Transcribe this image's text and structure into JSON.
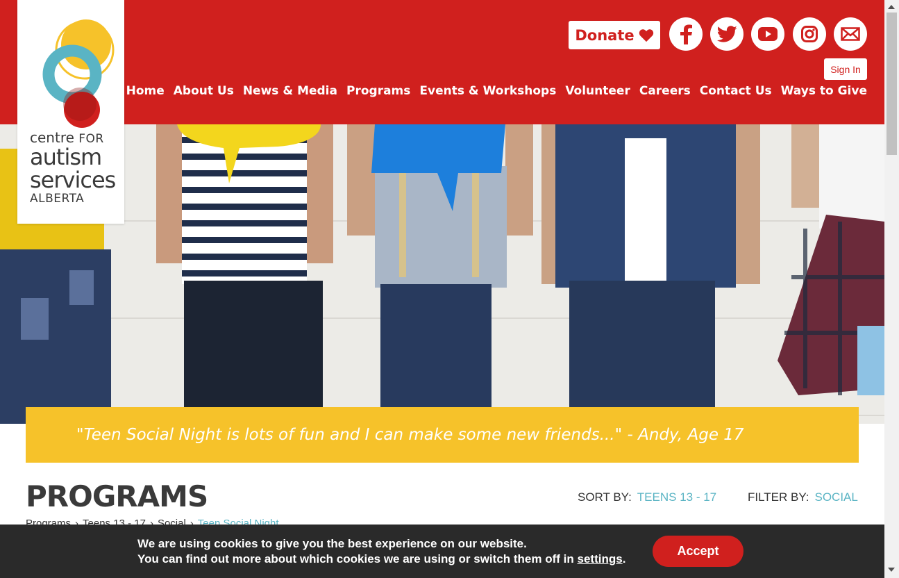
{
  "org": {
    "logo_line1": "centre",
    "logo_line1b": "FOR",
    "logo_line2": "autism",
    "logo_line3": "services",
    "logo_line4": "ALBERTA"
  },
  "header": {
    "donate_label": "Donate",
    "signin_label": "Sign In",
    "social": [
      "facebook-icon",
      "twitter-icon",
      "youtube-icon",
      "instagram-icon",
      "email-icon"
    ]
  },
  "nav": [
    "Home",
    "About Us",
    "News & Media",
    "Programs",
    "Events & Workshops",
    "Volunteer",
    "Careers",
    "Contact Us",
    "Ways to Give"
  ],
  "hero": {
    "quote": "\"Teen Social Night is lots of fun and I can make some new friends...\" - Andy, Age 17"
  },
  "programs": {
    "title": "PROGRAMS",
    "sort_label": "SORT BY:",
    "sort_value": "TEENS 13 - 17",
    "filter_label": "FILTER BY:",
    "filter_value": "SOCIAL",
    "breadcrumb": [
      "Programs",
      "Teens 13 - 17",
      "Social",
      "Teen Social Night"
    ]
  },
  "cookie": {
    "line1": "We are using cookies to give you the best experience on our website.",
    "line2_prefix": "You can find out more about which cookies we are using or switch them off in",
    "settings_link": "settings",
    "line2_suffix": ".",
    "accept_label": "Accept"
  },
  "colors": {
    "brand_red": "#d0201e",
    "brand_yellow": "#f6c22a",
    "brand_teal": "#5ab4c4",
    "cookie_bg": "#2a2a2a"
  }
}
